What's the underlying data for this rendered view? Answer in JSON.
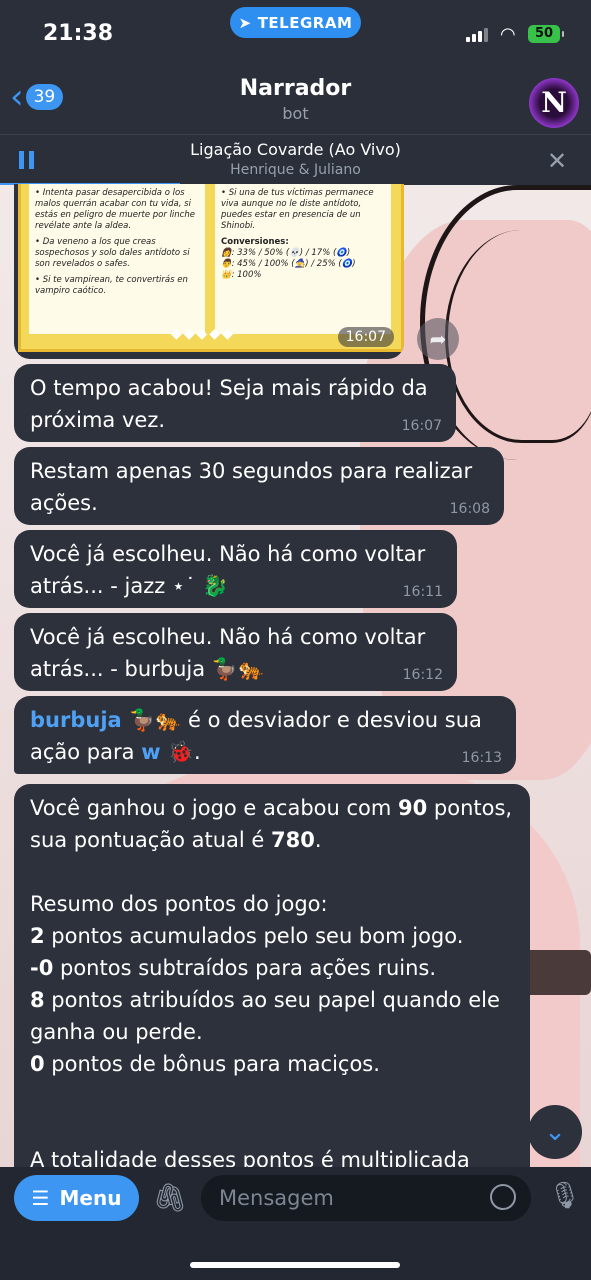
{
  "status_bar": {
    "time": "21:38",
    "pill": "TELEGRAM",
    "battery": "50"
  },
  "header": {
    "back_count": "39",
    "title": "Narrador",
    "subtitle": "bot",
    "avatar_letter": "N"
  },
  "player": {
    "track": "Ligação Covarde (Ao Vivo)",
    "artist": "Henrique & Juliano"
  },
  "photo": {
    "left_page": [
      "• Intenta pasar desapercibida o los malos querrán acabar con tu vida, si estás en peligro de muerte por linche revélate ante la aldea.",
      "• Da veneno a los que creas sospechosos y solo dales antídoto si son revelados o safes.",
      "• Si te vampirean, te convertirás en vampiro caótico."
    ],
    "right_page": [
      "• Si una de tus víctimas permanece viva aunque no le diste antídoto, puedes estar en presencia de un Shinobi."
    ],
    "conversions_title": "Conversiones:",
    "conversions": [
      "👩: 33% / 50% (💀) / 17% (🧿)",
      "👨: 45% / 100% (🧙) / 25% (🧿)",
      "👑: 100%"
    ],
    "time": "16:07"
  },
  "messages": [
    {
      "text": "O tempo acabou! Seja mais rápido da próxima vez.",
      "time": "16:07"
    },
    {
      "text": "Restam apenas 30 segundos para realizar ações.",
      "time": "16:08"
    },
    {
      "text": "Você já escolheu. Não há como voltar atrás... - jazz ⋆˙ 🐉",
      "time": "16:11"
    },
    {
      "text": "Você já escolheu. Não há como voltar atrás... - burbuja 🦆🐅",
      "time": "16:12"
    },
    {
      "link1": "burbuja 🦆🐅",
      "mid": " é o desviador e desviou sua ação para ",
      "link2": "w 🐞",
      "end": ".",
      "time": "16:13"
    }
  ],
  "long_message": {
    "p1_a": "Você ganhou o jogo e acabou com ",
    "p1_b": "90",
    "p1_c": " pontos, sua pontuação atual é ",
    "p1_d": "780",
    "p1_e": ".",
    "summary_title": "Resumo dos pontos do jogo:",
    "l1_n": "2",
    "l1_t": " pontos acumulados pelo seu bom jogo.",
    "l2_n": "-0",
    "l2_t": " pontos subtraídos para ações ruins.",
    "l3_n": "8",
    "l3_t": " pontos atribuídos ao seu papel quando ele ganha ou perde.",
    "l4_n": "0",
    "l4_t": " pontos de bônus para maciços.",
    "cut": "A totalidade desses pontos é multiplicada"
  },
  "composer": {
    "menu_label": "Menu",
    "placeholder": "Mensagem"
  },
  "colors": {
    "accent": "#3d96f2",
    "bubble": "#2c313b",
    "bar": "#2a2f3a"
  }
}
